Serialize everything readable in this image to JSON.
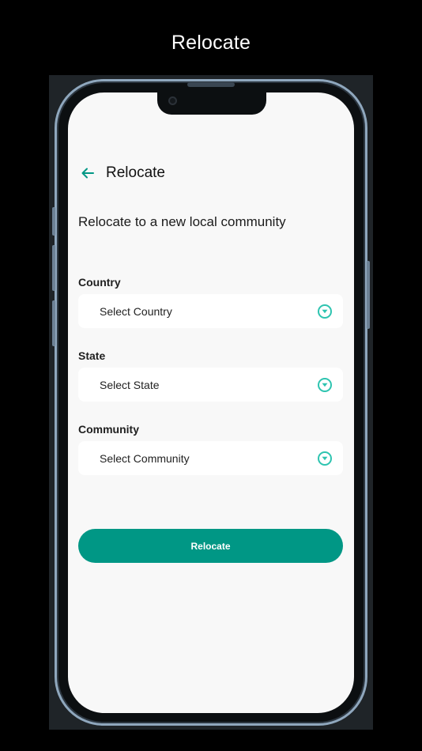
{
  "promo": {
    "title": "Relocate"
  },
  "header": {
    "title": "Relocate"
  },
  "subtitle": "Relocate to a new local community",
  "fields": [
    {
      "label": "Country",
      "placeholder": "Select Country"
    },
    {
      "label": "State",
      "placeholder": "Select State"
    },
    {
      "label": "Community",
      "placeholder": "Select Community"
    }
  ],
  "submit": {
    "label": "Relocate"
  },
  "icons": {
    "back": "arrow-left-icon",
    "dropdown": "chevron-down-circle-icon"
  },
  "colors": {
    "accent": "#009785",
    "chevron": "#2ec4b0",
    "screen_bg": "#f8f8f8"
  }
}
